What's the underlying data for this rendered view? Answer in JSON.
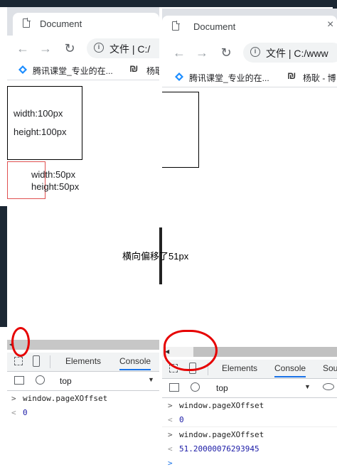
{
  "left_window": {
    "tab_title": "Document",
    "address_label": "文件",
    "address_value": "C:/",
    "bookmarks": [
      "腾讯课堂_专业的在...",
      "杨耿"
    ],
    "box_large": {
      "line1": "width:100px",
      "line2": "height:100px"
    },
    "box_small": {
      "line1": "width:50px",
      "line2": "height:50px"
    },
    "devtools": {
      "tabs": [
        "Elements",
        "Console"
      ],
      "context": "top",
      "console": [
        {
          "input": "window.pageXOffset",
          "output": "0"
        }
      ]
    }
  },
  "right_window": {
    "tab_title": "Document",
    "close_glyph": "×",
    "address_label": "文件",
    "address_value": "C:/www",
    "bookmarks": [
      "腾讯课堂_专业的在...",
      "杨耿 - 博"
    ],
    "devtools": {
      "tabs": [
        "Elements",
        "Console",
        "Sou"
      ],
      "context": "top",
      "console": [
        {
          "input": "window.pageXOffset",
          "output": "0"
        },
        {
          "input": "window.pageXOffset",
          "output": "51.20000076293945"
        }
      ]
    }
  },
  "caption": "横向偏移了51px",
  "colors": {
    "accent": "#1a73e8",
    "annotation_red": "#e60000",
    "small_box_border": "#e05050",
    "console_output_blue": "#1a1aa6"
  }
}
